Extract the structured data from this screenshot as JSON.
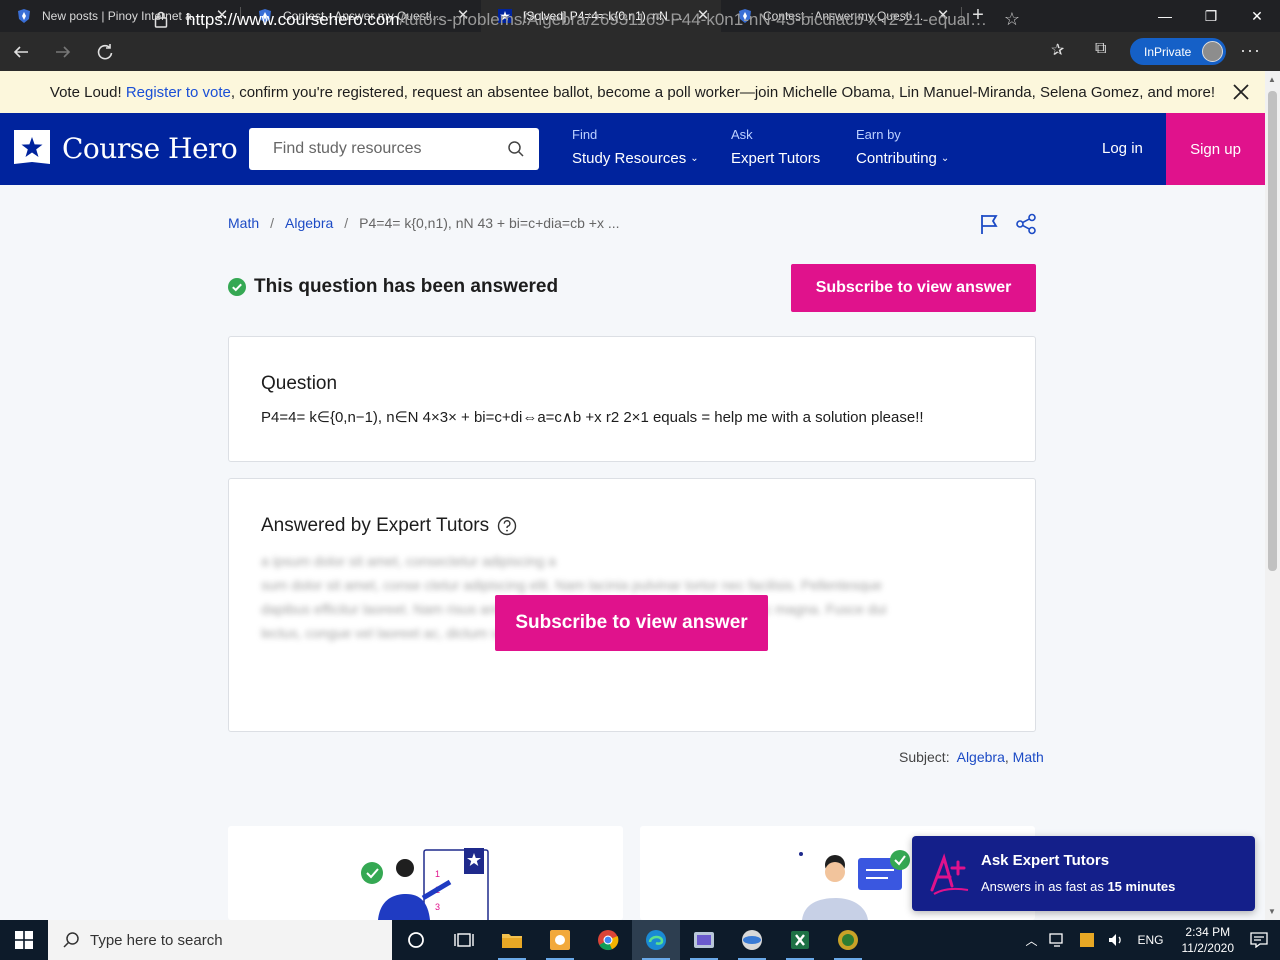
{
  "browser": {
    "tabs": [
      {
        "title": "New posts | Pinoy Internet and Te",
        "active": false
      },
      {
        "title": "Contest - Answer my Question y",
        "active": false
      },
      {
        "title": "[Solved] P4=4= k{0,n1), nN 43 +",
        "active": true
      },
      {
        "title": "Contest - Answer my Question y",
        "active": false
      }
    ],
    "url_host": "https://www.coursehero.com",
    "url_path": "/tutors-problems/Algebra/26931165-P44-k0n1-nN-43-bicdiacb-x-r2-21-equals-he...",
    "inprivate_label": "InPrivate"
  },
  "banner": {
    "prefix": "Vote Loud! ",
    "link": "Register to vote",
    "suffix": ", confirm you're registered, request an absentee ballot, become a poll worker—join Michelle Obama, Lin Manuel-Miranda, Selena Gomez, and more!"
  },
  "header": {
    "brand": "Course Hero",
    "search_placeholder": "Find study resources",
    "nav": [
      {
        "small": "Find",
        "big": "Study Resources",
        "dropdown": true
      },
      {
        "small": "Ask",
        "big": "Expert Tutors",
        "dropdown": false
      },
      {
        "small": "Earn by",
        "big": "Contributing",
        "dropdown": true
      }
    ],
    "login": "Log in",
    "signup": "Sign up"
  },
  "breadcrumb": {
    "items": [
      "Math",
      "Algebra"
    ],
    "current": "P4=4= k{0,n1), nN 43 + bi=c+dia=cb +x ..."
  },
  "status": {
    "answered_label": "This question has been answered",
    "subscribe_label": "Subscribe to view answer"
  },
  "question": {
    "title": "Question",
    "text": "P4=4= k∈{0,n−1), n∈N 4×3× + bi=c+di⇔a=c∧b +x r2 2×1 equals = help me with a solution please!!"
  },
  "answer": {
    "title": "Answered by Expert Tutors",
    "blurred": "a ipsum dolor sit amet, consectetur adipiscing a\nsum dolor sit amet, conse ctetur adipiscing elit. Nam lacinia pulvinar tortor nec facilisis. Pellentesque\ndapibus efficitur laoreet. Nam risus ante, dapibus a molestie consequat, ultrices ac magna. Fusce dui\nlectus, congue vel laoreet ac, dictum vitae odio.",
    "subscribe_label": "Subscribe to view answer"
  },
  "subject": {
    "label": "Subject: ",
    "links": [
      "Algebra",
      "Math"
    ]
  },
  "toast": {
    "title": "Ask Expert Tutors",
    "sub_prefix": "Answers in as fast as ",
    "sub_bold": "15 minutes"
  },
  "taskbar": {
    "search_placeholder": "Type here to search",
    "lang": "ENG",
    "time": "2:34 PM",
    "date": "11/2/2020"
  },
  "colors": {
    "brand_blue": "#00239d",
    "accent_pink": "#e0128c",
    "link_blue": "#1c4bc5",
    "check_green": "#35a853"
  }
}
